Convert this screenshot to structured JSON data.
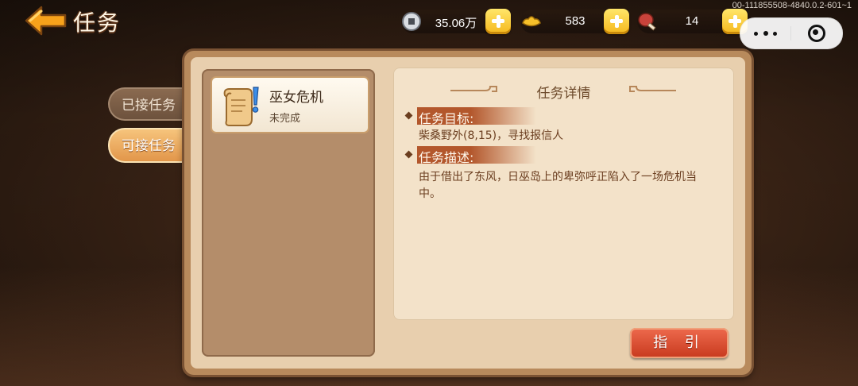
{
  "header": {
    "title": "任务",
    "debug": "00-111855508-4840.0.2-601~1"
  },
  "resources": {
    "silver": "35.06万",
    "gold": "583",
    "stamina": "14"
  },
  "tabs": {
    "accepted": "已接任务",
    "available": "可接任务"
  },
  "quest_list": [
    {
      "name": "巫女危机",
      "status": "未完成"
    }
  ],
  "detail": {
    "title": "任务详情",
    "goal_heading": "任务目标:",
    "goal_text": "柴桑野外(8,15)，寻找报信人",
    "desc_heading": "任务描述:",
    "desc_text": "由于借出了东风，日巫岛上的卑弥呼正陷入了一场危机当中。"
  },
  "guide_button": "指 引",
  "colors": {
    "panel_bg": "#e8cfae",
    "accent": "#c7391e",
    "tab_active": "#e2964a"
  }
}
